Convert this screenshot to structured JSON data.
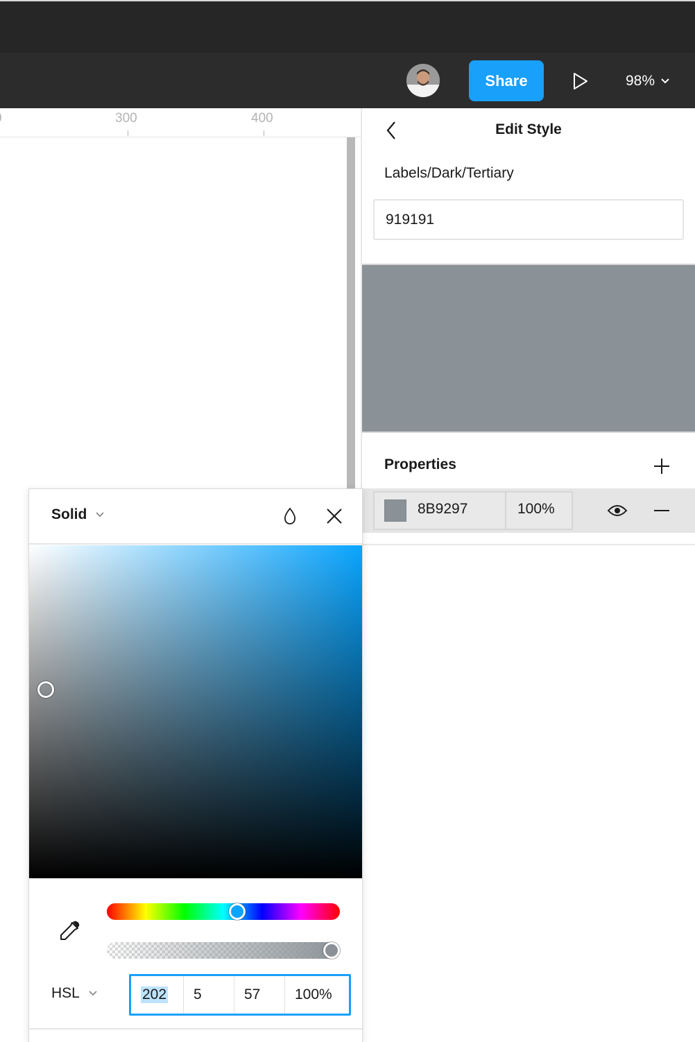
{
  "toolbar": {
    "share_label": "Share",
    "zoom_level": "98%",
    "colors": {
      "share": "#18a0fb",
      "bar": "#2c2c2c"
    }
  },
  "ruler": {
    "labels": [
      "0",
      "300",
      "400"
    ]
  },
  "panel": {
    "title": "Edit Style",
    "style_name": "Labels/Dark/Tertiary",
    "description_value": "919191",
    "preview_color": "#8b9297",
    "properties_title": "Properties",
    "fill": {
      "hex": "8B9297",
      "opacity": "100%"
    }
  },
  "picker": {
    "fill_type": "Solid",
    "mode": "HSL",
    "values": {
      "h": "202",
      "s": "5",
      "l": "57",
      "a": "100%"
    }
  }
}
